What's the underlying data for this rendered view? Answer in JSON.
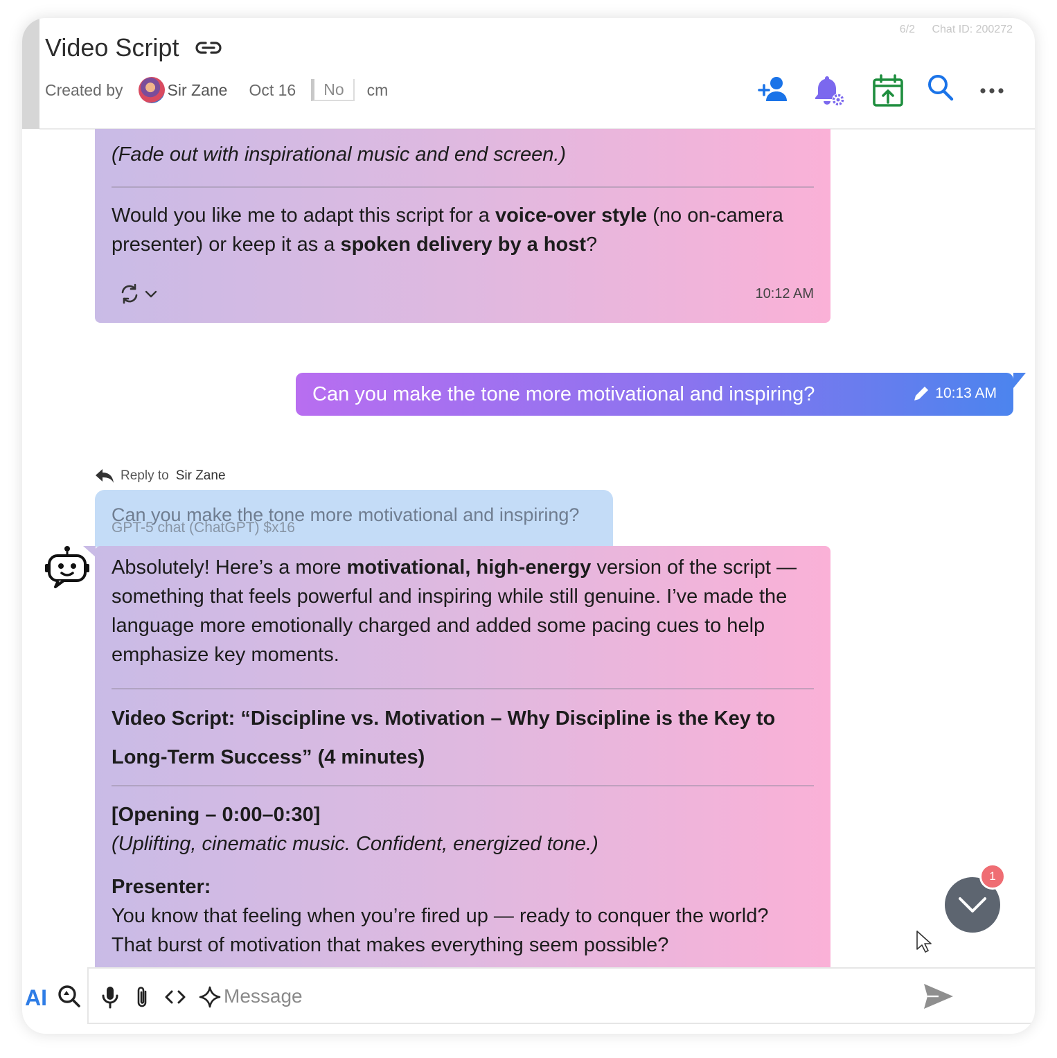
{
  "header": {
    "count": "6/2",
    "chat_id": "Chat ID: 200272",
    "title": "Video Script",
    "created_by_label": "Created by",
    "author": "Sir Zane",
    "date": "Oct 16",
    "status": "No",
    "tag": "cm",
    "icons": [
      "add-member-icon",
      "notification-settings-icon",
      "export-icon",
      "search-icon",
      "more-icon"
    ],
    "accent_color": "#1a73e8",
    "export_color": "#1e8e3e",
    "bell_color": "#7b68ee"
  },
  "messages": {
    "prev_bot": {
      "line1": "(Fade out with inspirational music and end screen.)",
      "q_pre": "Would you like me to adapt this script for a ",
      "q_b1": "voice-over style",
      "q_mid": " (no on-camera presenter) or keep it as a ",
      "q_b2": "spoken delivery by a host",
      "q_end": "?",
      "time": "10:12 AM"
    },
    "user": {
      "text": "Can you make the tone more motivational and inspiring?",
      "time": "10:13 AM"
    },
    "reply": {
      "label": "Reply to",
      "name": "Sir Zane",
      "quote": "Can you make the tone more motivational and inspiring?",
      "model": "GPT-5 chat (ChatGPT) $x16"
    },
    "bot": {
      "intro_pre": "Absolutely! Here’s a more ",
      "intro_bold": "motivational, high-energy",
      "intro_post": " version of the script — something that feels powerful and inspiring while still genuine. I’ve made the language more emotionally charged and added some pacing cues to help emphasize key moments.",
      "heading": "Video Script: “Discipline vs. Motivation – Why Discipline is the Key to Long-Term Success” (4 minutes)",
      "section": "[Opening – 0:00–0:30]",
      "cue": "(Uplifting, cinematic music. Confident, energized tone.)",
      "presenter": "Presenter:",
      "line": "You know that feeling when you’re fired up — ready to conquer the world? That burst of motivation that makes everything seem possible?"
    }
  },
  "composer": {
    "ai_label": "AI",
    "placeholder": "Message"
  },
  "scroll": {
    "badge": "1"
  }
}
